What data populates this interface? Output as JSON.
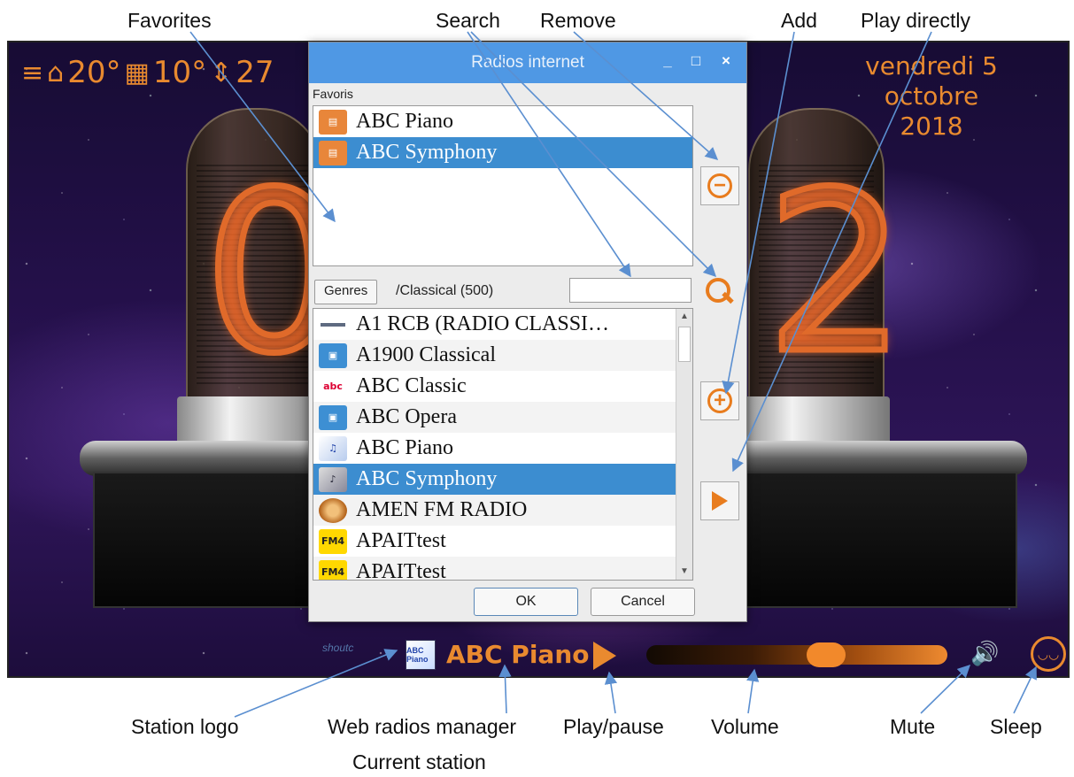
{
  "annotations": {
    "favorites": "Favorites",
    "search": "Search",
    "remove": "Remove",
    "add": "Add",
    "play_directly": "Play directly",
    "station_logo": "Station logo",
    "web_radios_manager": "Web radios manager",
    "current_station": "Current station",
    "play_pause": "Play/pause",
    "volume": "Volume",
    "mute": "Mute",
    "sleep": "Sleep"
  },
  "status": {
    "indoor_temp": "20°",
    "outdoor_temp": "10°",
    "pressure_partial": "27",
    "date_line1": "vendredi 5 octobre",
    "date_line2": "2018"
  },
  "clock": {
    "digit_left": "0",
    "digit_right": "2"
  },
  "player": {
    "shout_label": "shoutc",
    "current_station": "ABC Piano",
    "logo_text": "ABC Piano",
    "volume": 0.61
  },
  "dialog": {
    "title": "Radios internet",
    "minimize": "_",
    "maximize": "□",
    "close": "×",
    "favorites_label": "Favoris",
    "favorites": [
      {
        "name": "ABC Piano"
      },
      {
        "name": "ABC Symphony"
      }
    ],
    "genres_button": "Genres",
    "genre_path": "/Classical (500)",
    "search_value": "",
    "stations": [
      {
        "name": "A1 RCB (RADIO CLASSI…"
      },
      {
        "name": "A1900 Classical"
      },
      {
        "name": "ABC Classic"
      },
      {
        "name": "ABC Opera"
      },
      {
        "name": "ABC Piano"
      },
      {
        "name": "ABC Symphony"
      },
      {
        "name": "AMEN FM RADIO"
      },
      {
        "name": "APAITtest"
      },
      {
        "name": "APAITtest"
      }
    ],
    "ok": "OK",
    "cancel": "Cancel"
  },
  "colors": {
    "accent": "#e98a2f",
    "selection": "#3c8dd0",
    "titlebar": "#4f98e4"
  }
}
